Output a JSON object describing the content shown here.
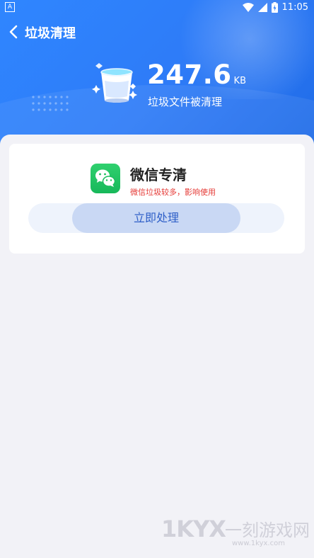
{
  "status_bar": {
    "time": "11:05",
    "notification_icon": "a-box-icon",
    "icons": [
      "wifi-icon",
      "signal-icon",
      "battery-charging-icon"
    ]
  },
  "header": {
    "title": "垃圾清理",
    "back_icon": "chevron-left-icon"
  },
  "summary": {
    "size_value": "247.6",
    "size_unit": "KB",
    "label": "垃圾文件被清理",
    "illustration_icon": "trash-bin-icon"
  },
  "card": {
    "app_icon": "wechat-icon",
    "title": "微信专清",
    "subtitle": "微信垃圾较多，影响使用",
    "button_label": "立即处理"
  },
  "watermark": {
    "logo": "1KYX",
    "text": "一刻游戏网",
    "url": "www.1kyx.com"
  },
  "colors": {
    "header_blue": "#2e7bf7",
    "warning_red": "#e53935",
    "button_text_blue": "#3060c8",
    "wechat_green": "#1fc360"
  }
}
